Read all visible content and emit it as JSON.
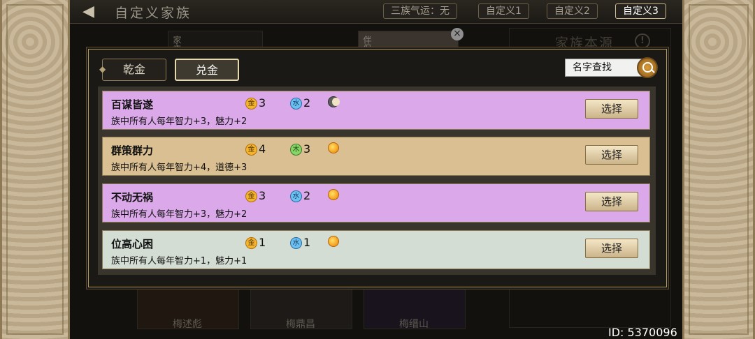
{
  "header": {
    "back_arrow": "◀",
    "title": "自定义家族",
    "tabs": [
      {
        "label": "三族气运：无"
      },
      {
        "label": "自定义1"
      },
      {
        "label": "自定义2"
      },
      {
        "label": "自定义3",
        "active": true
      }
    ]
  },
  "background": {
    "cards": [
      {
        "label": "家主"
      },
      {
        "label": "伴侣"
      }
    ],
    "names": [
      "梅述彪",
      "梅鼎昌",
      "梅缙山"
    ],
    "source_title": "家族本源",
    "player_id": "ID: 5370096"
  },
  "modal": {
    "close_icon": "×",
    "tabs": [
      {
        "label": "乾金",
        "active": false
      },
      {
        "label": "兑金",
        "active": true
      }
    ],
    "search_placeholder": "名字查找",
    "select_label": "选择",
    "rows": [
      {
        "name": "百谋皆遂",
        "desc": "族中所有人每年智力+3，魅力+2",
        "color": "#dba9ea",
        "stats": [
          {
            "icon": "gold-icon",
            "glyph": "金",
            "value": "3"
          },
          {
            "icon": "water-icon",
            "glyph": "水",
            "value": "2"
          }
        ],
        "orb": "moon"
      },
      {
        "name": "群策群力",
        "desc": "族中所有人每年智力+4，道德+3",
        "color": "#d9bf91",
        "stats": [
          {
            "icon": "gold-icon",
            "glyph": "金",
            "value": "4"
          },
          {
            "icon": "wood-icon",
            "glyph": "木",
            "value": "3"
          }
        ],
        "orb": "sun"
      },
      {
        "name": "不动无祸",
        "desc": "族中所有人每年智力+3，魅力+2",
        "color": "#dba9ea",
        "stats": [
          {
            "icon": "gold-icon",
            "glyph": "金",
            "value": "3"
          },
          {
            "icon": "water-icon",
            "glyph": "水",
            "value": "2"
          }
        ],
        "orb": "sun"
      },
      {
        "name": "位高心困",
        "desc": "族中所有人每年智力+1，魅力+1",
        "color": "#d3ddd4",
        "stats": [
          {
            "icon": "gold-icon",
            "glyph": "金",
            "value": "1"
          },
          {
            "icon": "water-icon",
            "glyph": "水",
            "value": "1"
          }
        ],
        "orb": "sun"
      }
    ]
  }
}
